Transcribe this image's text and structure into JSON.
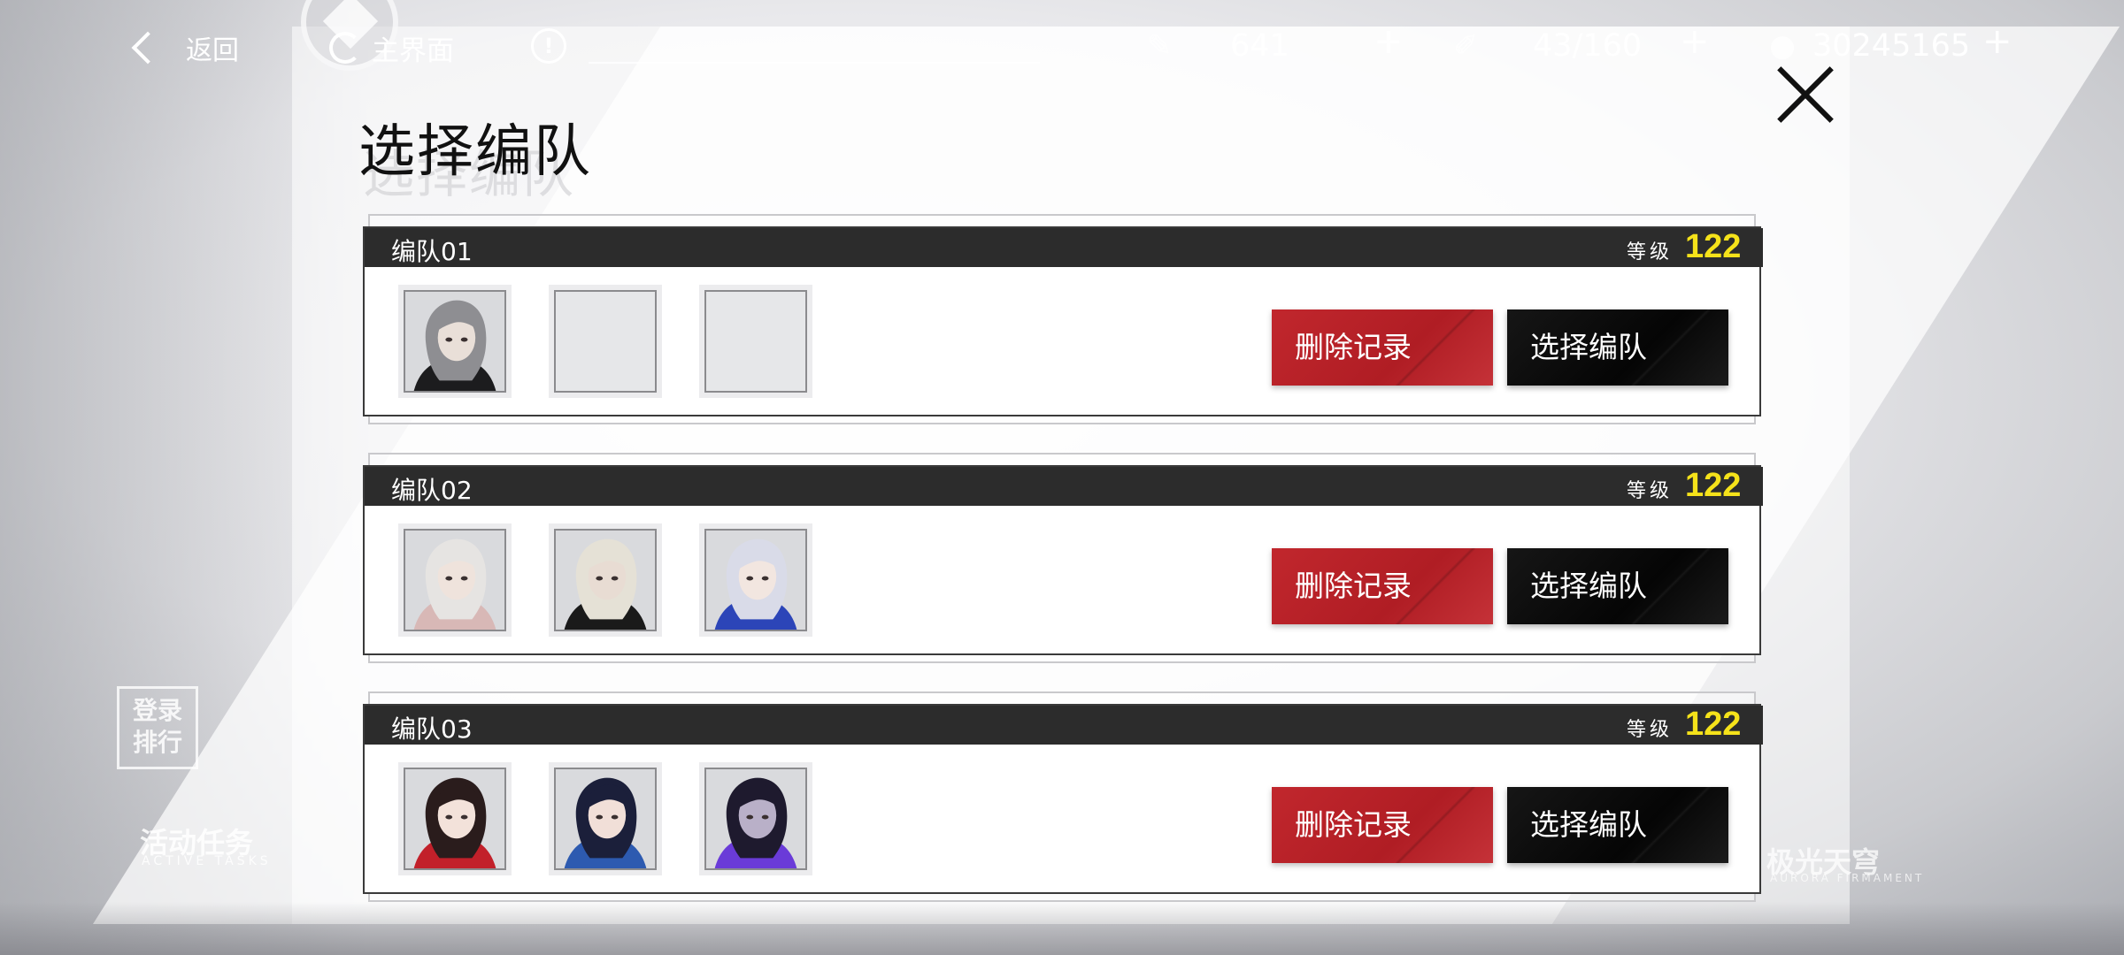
{
  "topbar": {
    "back_label": "返回",
    "home_label": "主界面",
    "info_symbol": "!",
    "currencies": [
      {
        "icon": "stamina-icon",
        "value": "641",
        "plus": "+"
      },
      {
        "icon": "pen-icon",
        "value": "43/160",
        "plus": "+"
      },
      {
        "icon": "coin-icon",
        "value": "30245165",
        "plus": "+"
      }
    ]
  },
  "page": {
    "title": "选择编队"
  },
  "background": {
    "deco_ranking": "登录\n排行",
    "deco_activity": "活动任务",
    "deco_activity_sub": "ACTIVE TASKS",
    "deco_right": "极光天穹",
    "deco_right_sub": "AURORA FIRMAMENT"
  },
  "teams": [
    {
      "name": "编队01",
      "level_label": "等级",
      "level": "122",
      "delete_label": "删除记录",
      "select_label": "选择编队",
      "members": [
        {
          "filled": true,
          "hair": "#8e8e92",
          "skin": "#e9dfd8",
          "outfit": "#1c1c1e"
        },
        {
          "filled": false
        },
        {
          "filled": false
        }
      ]
    },
    {
      "name": "编队02",
      "level_label": "等级",
      "level": "122",
      "delete_label": "删除记录",
      "select_label": "选择编队",
      "members": [
        {
          "filled": true,
          "hair": "#e6e4e2",
          "skin": "#efe3dc",
          "outfit": "#d8b8b6"
        },
        {
          "filled": true,
          "hair": "#e5e1d6",
          "skin": "#e8dcd3",
          "outfit": "#1a1a1a"
        },
        {
          "filled": true,
          "hair": "#d9dbe8",
          "skin": "#f2e6e0",
          "outfit": "#2c45b8"
        }
      ]
    },
    {
      "name": "编队03",
      "level_label": "等级",
      "level": "122",
      "delete_label": "删除记录",
      "select_label": "选择编队",
      "members": [
        {
          "filled": true,
          "hair": "#2a1c1c",
          "skin": "#f3e2da",
          "outfit": "#c2202a"
        },
        {
          "filled": true,
          "hair": "#1b1f3a",
          "skin": "#f1dfd8",
          "outfit": "#2d5ab0"
        },
        {
          "filled": true,
          "hair": "#1e1a2e",
          "skin": "#b9b0c8",
          "outfit": "#6a3bd8"
        }
      ]
    }
  ],
  "colors": {
    "accent_red": "#c1272d",
    "level_yellow": "#f5e21a",
    "header_dark": "#2c2c2c"
  }
}
